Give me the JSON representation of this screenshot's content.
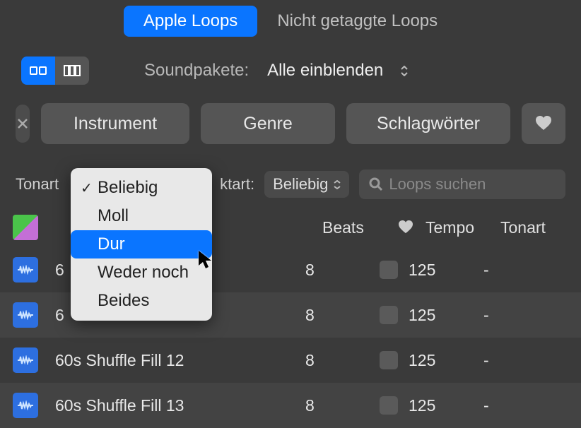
{
  "tabs": {
    "active": "Apple Loops",
    "inactive": "Nicht getaggte Loops"
  },
  "soundpacks": {
    "label": "Soundpakete:",
    "value": "Alle einblenden"
  },
  "filters": {
    "instrument": "Instrument",
    "genre": "Genre",
    "descriptors": "Schlagwörter"
  },
  "row4": {
    "tonart_label": "Tonart",
    "taktart_label": "ktart:",
    "taktart_value": "Beliebig",
    "search_placeholder": "Loops suchen"
  },
  "dropdown": {
    "options": [
      "Beliebig",
      "Moll",
      "Dur",
      "Weder noch",
      "Beides"
    ],
    "checked_index": 0,
    "highlighted_index": 2
  },
  "columns": {
    "beats": "Beats",
    "tempo": "Tempo",
    "tonart": "Tonart"
  },
  "rows": [
    {
      "name": "6",
      "beats": "8",
      "tempo": "125",
      "key": "-"
    },
    {
      "name": "6",
      "beats": "8",
      "tempo": "125",
      "key": "-"
    },
    {
      "name": "60s Shuffle Fill 12",
      "beats": "8",
      "tempo": "125",
      "key": "-"
    },
    {
      "name": "60s Shuffle Fill 13",
      "beats": "8",
      "tempo": "125",
      "key": "-"
    }
  ]
}
